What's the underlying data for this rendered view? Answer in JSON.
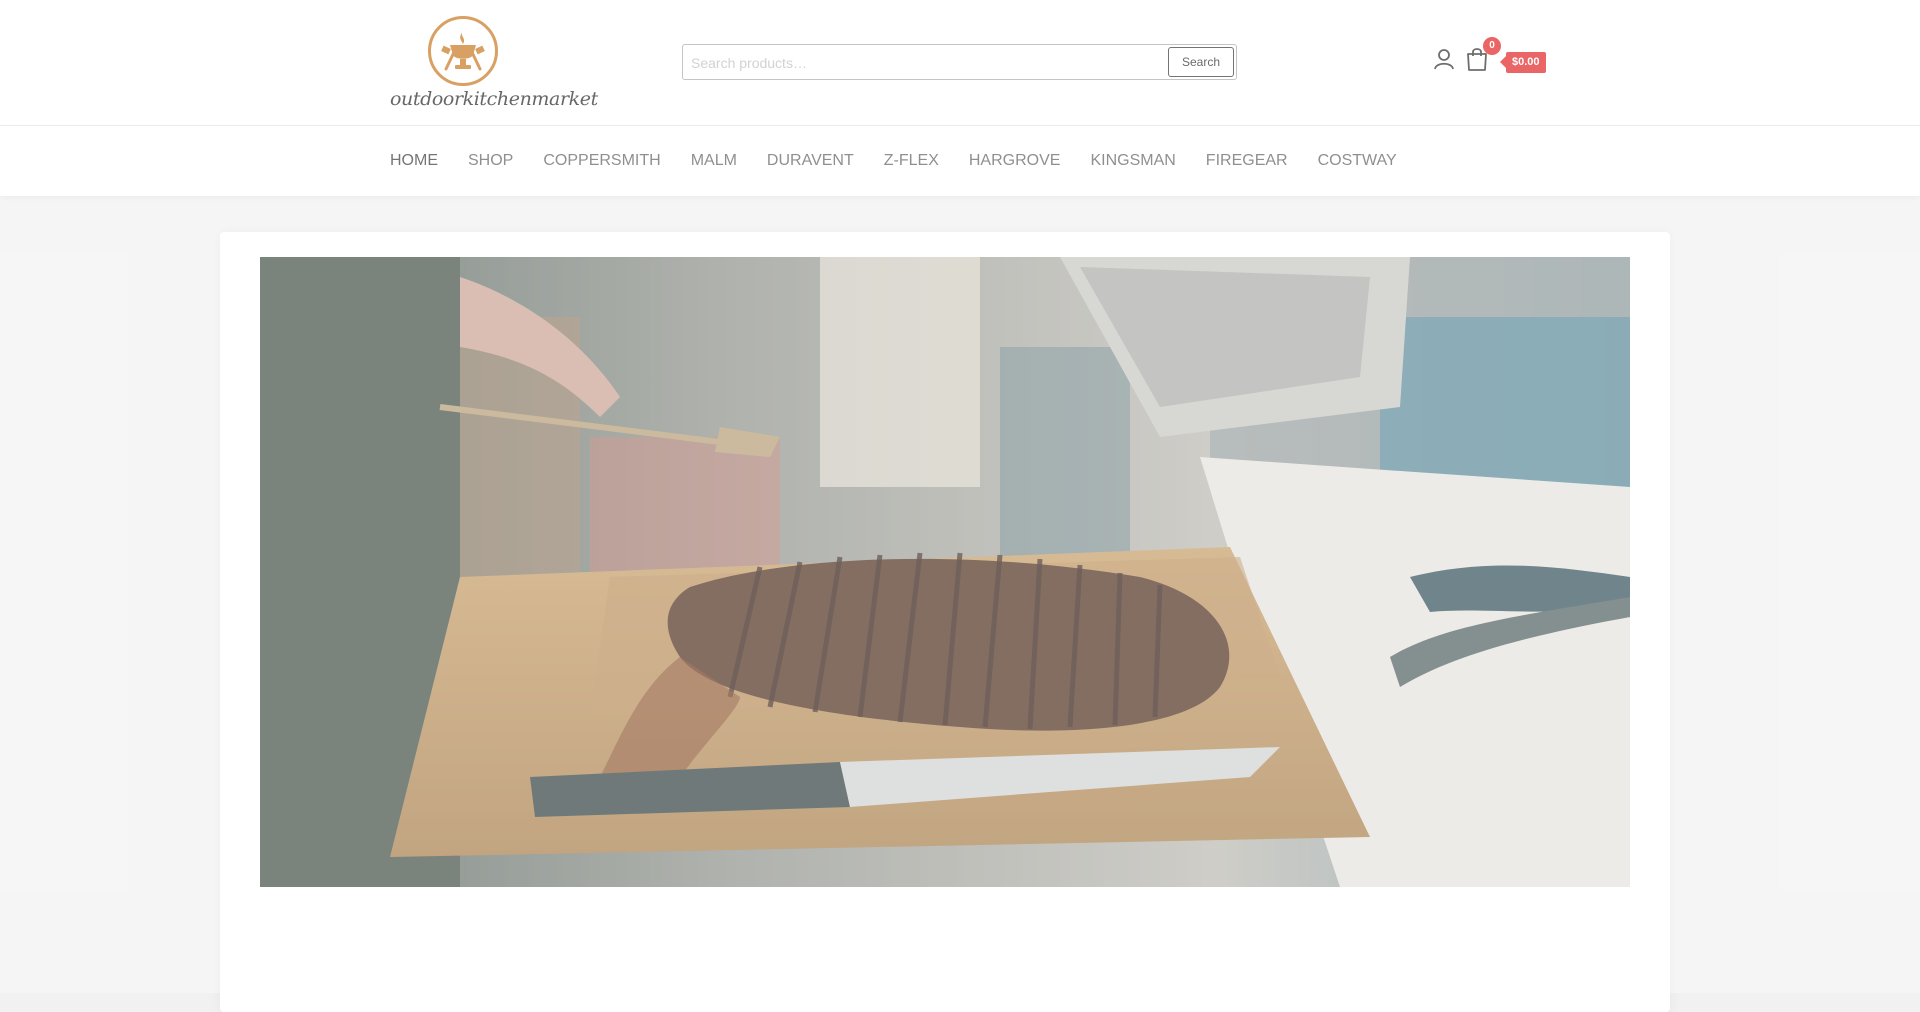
{
  "logo": {
    "text": "outdoorkitchenmarket",
    "icon": "grill-trophy-icon",
    "brand_color": "#c8731b"
  },
  "search": {
    "placeholder": "Search products…",
    "value": "",
    "button_label": "Search"
  },
  "header_icons": {
    "account": "user-icon",
    "cart": "shopping-bag-icon"
  },
  "cart": {
    "count": "0",
    "total": "$0.00",
    "badge_color": "#e11d1d"
  },
  "nav": {
    "items": [
      {
        "label": "HOME",
        "active": true
      },
      {
        "label": "SHOP"
      },
      {
        "label": "COPPERSMITH"
      },
      {
        "label": "MALM"
      },
      {
        "label": "DURAVENT"
      },
      {
        "label": "Z-FLEX"
      },
      {
        "label": "HARGROVE"
      },
      {
        "label": "KINGSMAN"
      },
      {
        "label": "FIREGEAR"
      },
      {
        "label": "COSTWAY"
      }
    ]
  },
  "hero": {
    "image": "sliced grilled steak on a wooden cutting board with a knife"
  }
}
